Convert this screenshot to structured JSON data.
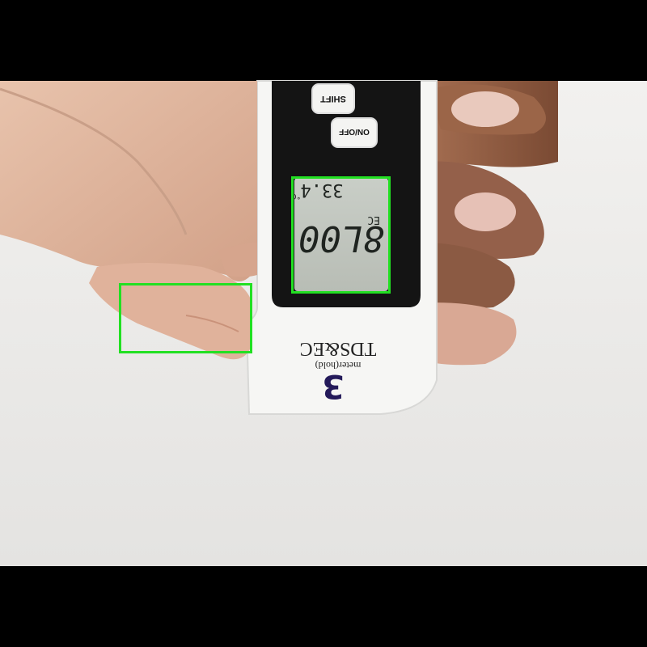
{
  "photo": {
    "device": {
      "buttons": [
        {
          "label": "SHIFT"
        },
        {
          "label": "ON/OFF"
        }
      ],
      "display": {
        "temperature_reading": "33.4",
        "temperature_unit": "°C",
        "main_reading": "8L00",
        "mode_label": "EC"
      },
      "brand": {
        "line1": "TDS&EC",
        "line2": "meter(hold)"
      },
      "handwritten_marking": "3"
    }
  },
  "annotations": {
    "box_color": "#22e022",
    "boxes": [
      {
        "name": "display-highlight-box"
      },
      {
        "name": "thumb-highlight-box"
      }
    ]
  }
}
